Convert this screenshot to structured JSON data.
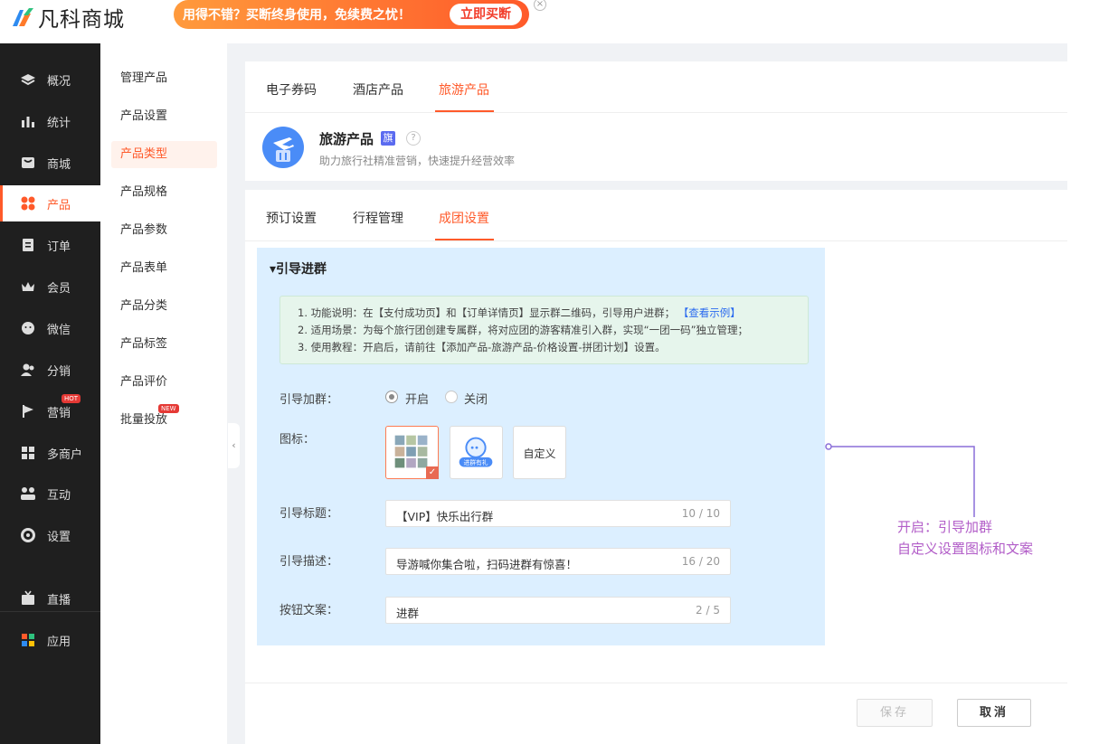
{
  "header": {
    "logo_text": "凡科商城",
    "promo_text": "用得不错？买断终身使用，免续费之忧！",
    "promo_button": "立即买断",
    "promo_close": "×"
  },
  "sidebar": {
    "items": [
      {
        "label": "概况",
        "icon": "layers-icon"
      },
      {
        "label": "统计",
        "icon": "chart-icon"
      },
      {
        "label": "商城",
        "icon": "shop-icon"
      },
      {
        "label": "产品",
        "icon": "product-icon",
        "active": true
      },
      {
        "label": "订单",
        "icon": "order-icon"
      },
      {
        "label": "会员",
        "icon": "crown-icon"
      },
      {
        "label": "微信",
        "icon": "wechat-icon"
      },
      {
        "label": "分销",
        "icon": "user-icon"
      },
      {
        "label": "营销",
        "icon": "flag-icon",
        "badge": "HOT"
      },
      {
        "label": "多商户",
        "icon": "store-icon"
      },
      {
        "label": "互动",
        "icon": "interact-icon"
      },
      {
        "label": "设置",
        "icon": "gear-icon"
      },
      {
        "label": "直播",
        "icon": "tv-icon"
      },
      {
        "label": "应用",
        "icon": "apps-icon"
      }
    ]
  },
  "subnav": {
    "items": [
      "管理产品",
      "产品设置",
      "产品类型",
      "产品规格",
      "产品参数",
      "产品表单",
      "产品分类",
      "产品标签",
      "产品评价",
      "批量投放"
    ],
    "new_badge": "NEW"
  },
  "top_tabs": [
    "电子券码",
    "酒店产品",
    "旅游产品"
  ],
  "product": {
    "title": "旅游产品",
    "flag": "旗",
    "help": "?",
    "subtitle": "助力旅行社精准营销，快速提升经营效率"
  },
  "sub_tabs": [
    "预订设置",
    "行程管理",
    "成团设置"
  ],
  "section": {
    "title": "▾引导进群",
    "notice": {
      "line1": "1. 功能说明：在【支付成功页】和【订单详情页】显示群二维码，引导用户进群；",
      "line1_link": "【查看示例】",
      "line2": "2. 适用场景：为每个旅行团创建专属群，将对应团的游客精准引入群，实现“一团一码”独立管理；",
      "line3": "3. 使用教程：开启后，请前往【添加产品-旅游产品-价格设置-拼团计划】设置。"
    }
  },
  "form": {
    "join_label": "引导加群：",
    "radio_on": "开启",
    "radio_off": "关闭",
    "icon_label": "图标：",
    "icon_custom": "自定义",
    "icon_badge_text": "进群有礼",
    "title_label": "引导标题：",
    "title_value": "【VIP】快乐出行群",
    "title_count": "10 / 10",
    "desc_label": "引导描述：",
    "desc_value": "导游喊你集合啦，扫码进群有惊喜！",
    "desc_count": "16 / 20",
    "btn_label": "按钮文案：",
    "btn_value": "进群",
    "btn_count": "2 / 5"
  },
  "annotation": {
    "line1": "开启：引导加群",
    "line2": "自定义设置图标和文案"
  },
  "footer": {
    "save": "保存",
    "cancel": "取消"
  },
  "collapse_glyph": "‹",
  "colors": {
    "accent": "#ff5a2a",
    "sidebar_bg": "#1f1f1f",
    "highlight_bg": "#dcefff",
    "annotation": "#b25dc8"
  }
}
